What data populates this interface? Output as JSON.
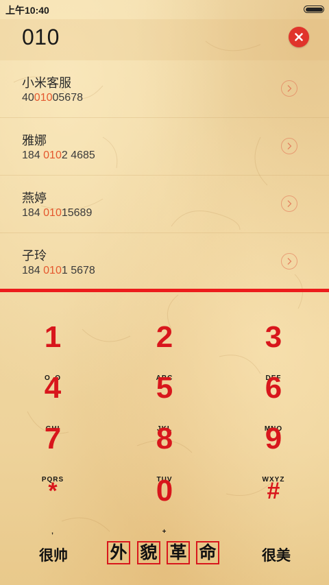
{
  "status_bar": {
    "time": "上午10:40",
    "battery_icon": "battery-icon"
  },
  "dialer": {
    "number": "010",
    "clear_icon": "close-icon",
    "highlight_color": "#e4572e"
  },
  "contacts": [
    {
      "name": "小米客服",
      "number_before": "40",
      "number_match": "010",
      "number_after": "05678"
    },
    {
      "name": "雅娜",
      "number_before": "184 ",
      "number_match": "010",
      "number_after": "2 4685"
    },
    {
      "name": "燕婷",
      "number_before": "184 ",
      "number_match": "010",
      "number_after": "15689"
    },
    {
      "name": "子玲",
      "number_before": "184 ",
      "number_match": "010",
      "number_after": "1 5678"
    }
  ],
  "keypad": {
    "digit_color": "#d8161c",
    "keys": [
      {
        "digit": "1",
        "letters": "O_O"
      },
      {
        "digit": "2",
        "letters": "ABC"
      },
      {
        "digit": "3",
        "letters": "DEF"
      },
      {
        "digit": "4",
        "letters": "GHI"
      },
      {
        "digit": "5",
        "letters": "JKL"
      },
      {
        "digit": "6",
        "letters": "MNO"
      },
      {
        "digit": "7",
        "letters": "PQRS"
      },
      {
        "digit": "8",
        "letters": "TUV"
      },
      {
        "digit": "9",
        "letters": "WXYZ"
      },
      {
        "digit": "*",
        "letters": ","
      },
      {
        "digit": "0",
        "letters": "+"
      },
      {
        "digit": "#",
        "letters": ""
      }
    ]
  },
  "bottom_bar": {
    "left_label": "很帅",
    "stamp_chars": [
      "外",
      "貌",
      "革",
      "命"
    ],
    "right_label": "很美"
  }
}
